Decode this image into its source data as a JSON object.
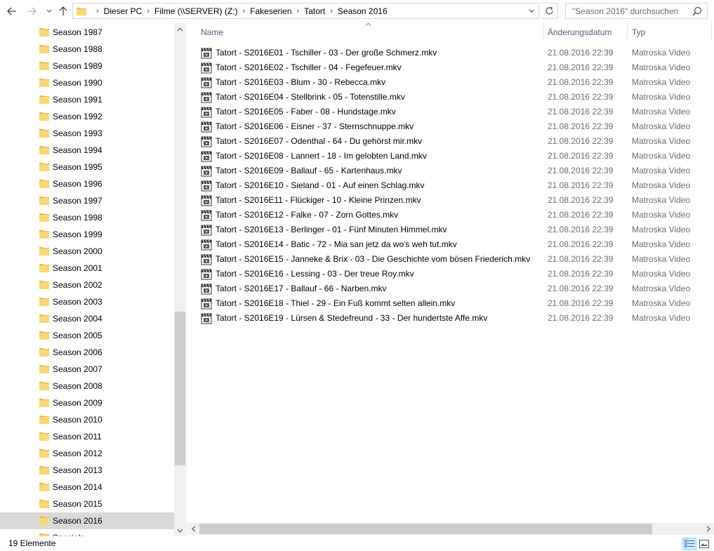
{
  "address": {
    "breadcrumbs": [
      "Dieser PC",
      "Filme (\\\\SERVER) (Z:)",
      "Fakeserien",
      "Tatort",
      "Season 2016"
    ],
    "search_placeholder": "\"Season 2016\" durchsuchen"
  },
  "nav": {
    "items": [
      {
        "label": "Season 1987"
      },
      {
        "label": "Season 1988"
      },
      {
        "label": "Season 1989"
      },
      {
        "label": "Season 1990"
      },
      {
        "label": "Season 1991"
      },
      {
        "label": "Season 1992"
      },
      {
        "label": "Season 1993"
      },
      {
        "label": "Season 1994"
      },
      {
        "label": "Season 1995"
      },
      {
        "label": "Season 1996"
      },
      {
        "label": "Season 1997"
      },
      {
        "label": "Season 1998"
      },
      {
        "label": "Season 1999"
      },
      {
        "label": "Season 2000"
      },
      {
        "label": "Season 2001"
      },
      {
        "label": "Season 2002"
      },
      {
        "label": "Season 2003"
      },
      {
        "label": "Season 2004"
      },
      {
        "label": "Season 2005"
      },
      {
        "label": "Season 2006"
      },
      {
        "label": "Season 2007"
      },
      {
        "label": "Season 2008"
      },
      {
        "label": "Season 2009"
      },
      {
        "label": "Season 2010"
      },
      {
        "label": "Season 2011"
      },
      {
        "label": "Season 2012"
      },
      {
        "label": "Season 2013"
      },
      {
        "label": "Season 2014"
      },
      {
        "label": "Season 2015"
      },
      {
        "label": "Season 2016",
        "selected": true
      },
      {
        "label": "Specials"
      }
    ]
  },
  "columns": {
    "name": "Name",
    "date": "Änderungsdatum",
    "type": "Typ"
  },
  "files": [
    {
      "name": "Tatort - S2016E01 - Tschiller - 03 - Der große Schmerz.mkv",
      "date": "21.08.2016 22:39",
      "type": "Matroska Video"
    },
    {
      "name": "Tatort - S2016E02 - Tschiller - 04 - Fegefeuer.mkv",
      "date": "21.08.2016 22:39",
      "type": "Matroska Video"
    },
    {
      "name": "Tatort - S2016E03 - Blum - 30 - Rebecca.mkv",
      "date": "21.08.2016 22:39",
      "type": "Matroska Video"
    },
    {
      "name": "Tatort - S2016E04 - Stellbrink - 05 - Totenstille.mkv",
      "date": "21.08.2016 22:39",
      "type": "Matroska Video"
    },
    {
      "name": "Tatort - S2016E05 - Faber - 08 - Hundstage.mkv",
      "date": "21.08.2016 22:39",
      "type": "Matroska Video"
    },
    {
      "name": "Tatort - S2016E06 - Eisner - 37 - Sternschnuppe.mkv",
      "date": "21.08.2016 22:39",
      "type": "Matroska Video"
    },
    {
      "name": "Tatort - S2016E07 - Odenthal - 64 - Du gehörst mir.mkv",
      "date": "21.08.2016 22:39",
      "type": "Matroska Video"
    },
    {
      "name": "Tatort - S2016E08 - Lannert - 18 - Im gelobten Land.mkv",
      "date": "21.08.2016 22:39",
      "type": "Matroska Video"
    },
    {
      "name": "Tatort - S2016E09 - Ballauf - 65 - Kartenhaus.mkv",
      "date": "21.08.2016 22:39",
      "type": "Matroska Video"
    },
    {
      "name": "Tatort - S2016E10 - Sieland - 01 - Auf einen Schlag.mkv",
      "date": "21.08.2016 22:39",
      "type": "Matroska Video"
    },
    {
      "name": "Tatort - S2016E11 - Flückiger - 10 - Kleine Prinzen.mkv",
      "date": "21.08.2016 22:39",
      "type": "Matroska Video"
    },
    {
      "name": "Tatort - S2016E12 - Falke - 07 - Zorn Gottes.mkv",
      "date": "21.08.2016 22:39",
      "type": "Matroska Video"
    },
    {
      "name": "Tatort - S2016E13 - Berlinger - 01 - Fünf Minuten Himmel.mkv",
      "date": "21.08.2016 22:39",
      "type": "Matroska Video"
    },
    {
      "name": "Tatort - S2016E14 - Batic - 72 - Mia san jetz da wo's weh tut.mkv",
      "date": "21.08.2016 22:39",
      "type": "Matroska Video"
    },
    {
      "name": "Tatort - S2016E15 - Janneke & Brix - 03 - Die Geschichte vom bösen Friederich.mkv",
      "date": "21.08.2016 22:39",
      "type": "Matroska Video"
    },
    {
      "name": "Tatort - S2016E16 - Lessing - 03 - Der treue Roy.mkv",
      "date": "21.08.2016 22:39",
      "type": "Matroska Video"
    },
    {
      "name": "Tatort - S2016E17 - Ballauf - 66 - Narben.mkv",
      "date": "21.08.2016 22:39",
      "type": "Matroska Video"
    },
    {
      "name": "Tatort - S2016E18 - Thiel - 29 - Ein Fuß kommt selten allein.mkv",
      "date": "21.08.2016 22:39",
      "type": "Matroska Video"
    },
    {
      "name": "Tatort - S2016E19 - Lürsen & Stedefreund - 33 - Der hundertste Affe.mkv",
      "date": "21.08.2016 22:39",
      "type": "Matroska Video"
    }
  ],
  "status": {
    "count": "19 Elemente"
  },
  "colors": {
    "folder": "#f8d775",
    "selection": "#d9d9d9",
    "column_header": "#4c607a",
    "secondary_text": "#6d6d6d"
  }
}
